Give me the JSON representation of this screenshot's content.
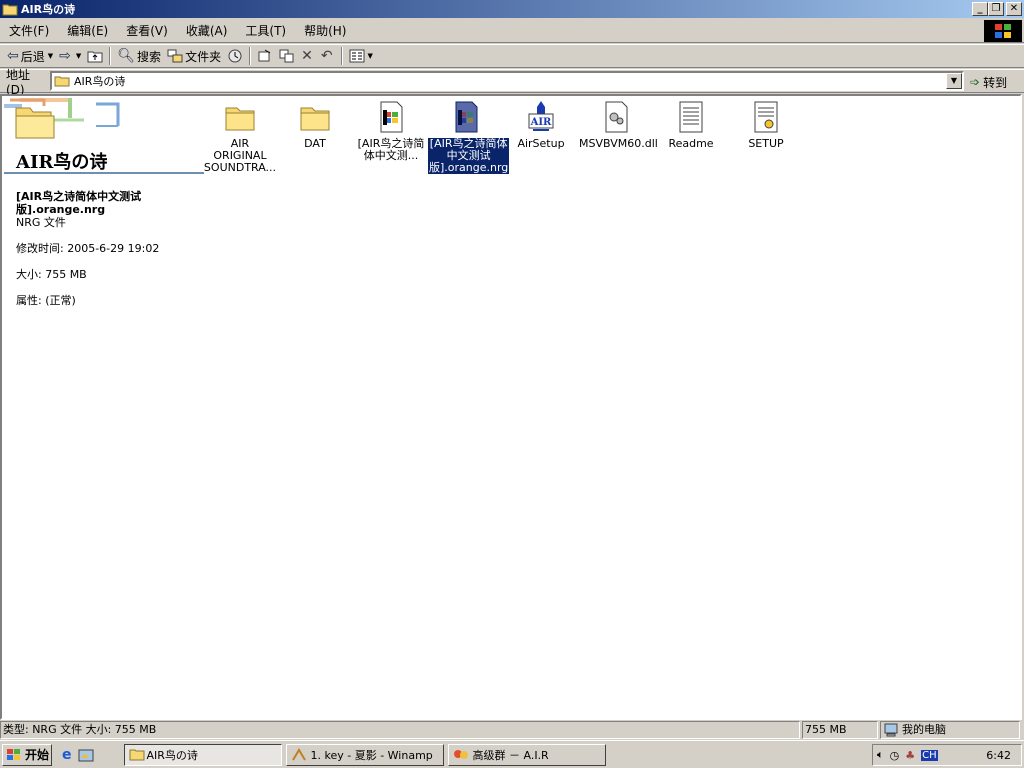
{
  "window": {
    "title": "AIR鸟の诗",
    "buttons": {
      "minimize": "_",
      "restore": "❐",
      "close": "✕"
    }
  },
  "menu": [
    "文件(F)",
    "编辑(E)",
    "查看(V)",
    "收藏(A)",
    "工具(T)",
    "帮助(H)"
  ],
  "toolbar": {
    "back": "后退",
    "forward": "⇨",
    "search": "搜索",
    "folders": "文件夹"
  },
  "address": {
    "label": "地址(D)",
    "value": "AIR鸟の诗",
    "go": "转到"
  },
  "panel": {
    "title": "AIR鸟の诗",
    "selected_name": "[AIR鸟之诗简体中文测试版].orange.nrg",
    "file_type": "NRG 文件",
    "modified": "修改时间: 2005-6-29 19:02",
    "size": "大小: 755 MB",
    "attributes": "属性: (正常)"
  },
  "files": [
    {
      "label": "AIR ORIGINAL SOUNDTRA...",
      "icon": "folder-icon"
    },
    {
      "label": "DAT",
      "icon": "folder-icon"
    },
    {
      "label": "[AIR鸟之诗简体中文测...",
      "icon": "nero-image-icon"
    },
    {
      "label": "[AIR鸟之诗简体中文测试版].orange.nrg",
      "icon": "nero-image-icon",
      "selected": true
    },
    {
      "label": "AirSetup",
      "icon": "setup-app-icon"
    },
    {
      "label": "MSVBVM60.dll",
      "icon": "dll-icon"
    },
    {
      "label": "Readme",
      "icon": "text-document-icon"
    },
    {
      "label": "SETUP",
      "icon": "setup-ini-icon"
    }
  ],
  "statusbar": {
    "info": "类型: NRG 文件 大小: 755 MB",
    "size": "755 MB",
    "zone": "我的电脑"
  },
  "taskbar": {
    "start": "开始",
    "tasks": [
      {
        "label": "AIR鸟の诗",
        "active": true
      },
      {
        "label": "1. key - 夏影 - Winamp",
        "active": false
      },
      {
        "label": "高级群 － A.I.R",
        "active": false
      }
    ],
    "lang": "CH",
    "clock": "6:42"
  },
  "colors": {
    "selection": "#0a246a",
    "titlebar": "#0a246a",
    "face": "#d4d0c8"
  }
}
